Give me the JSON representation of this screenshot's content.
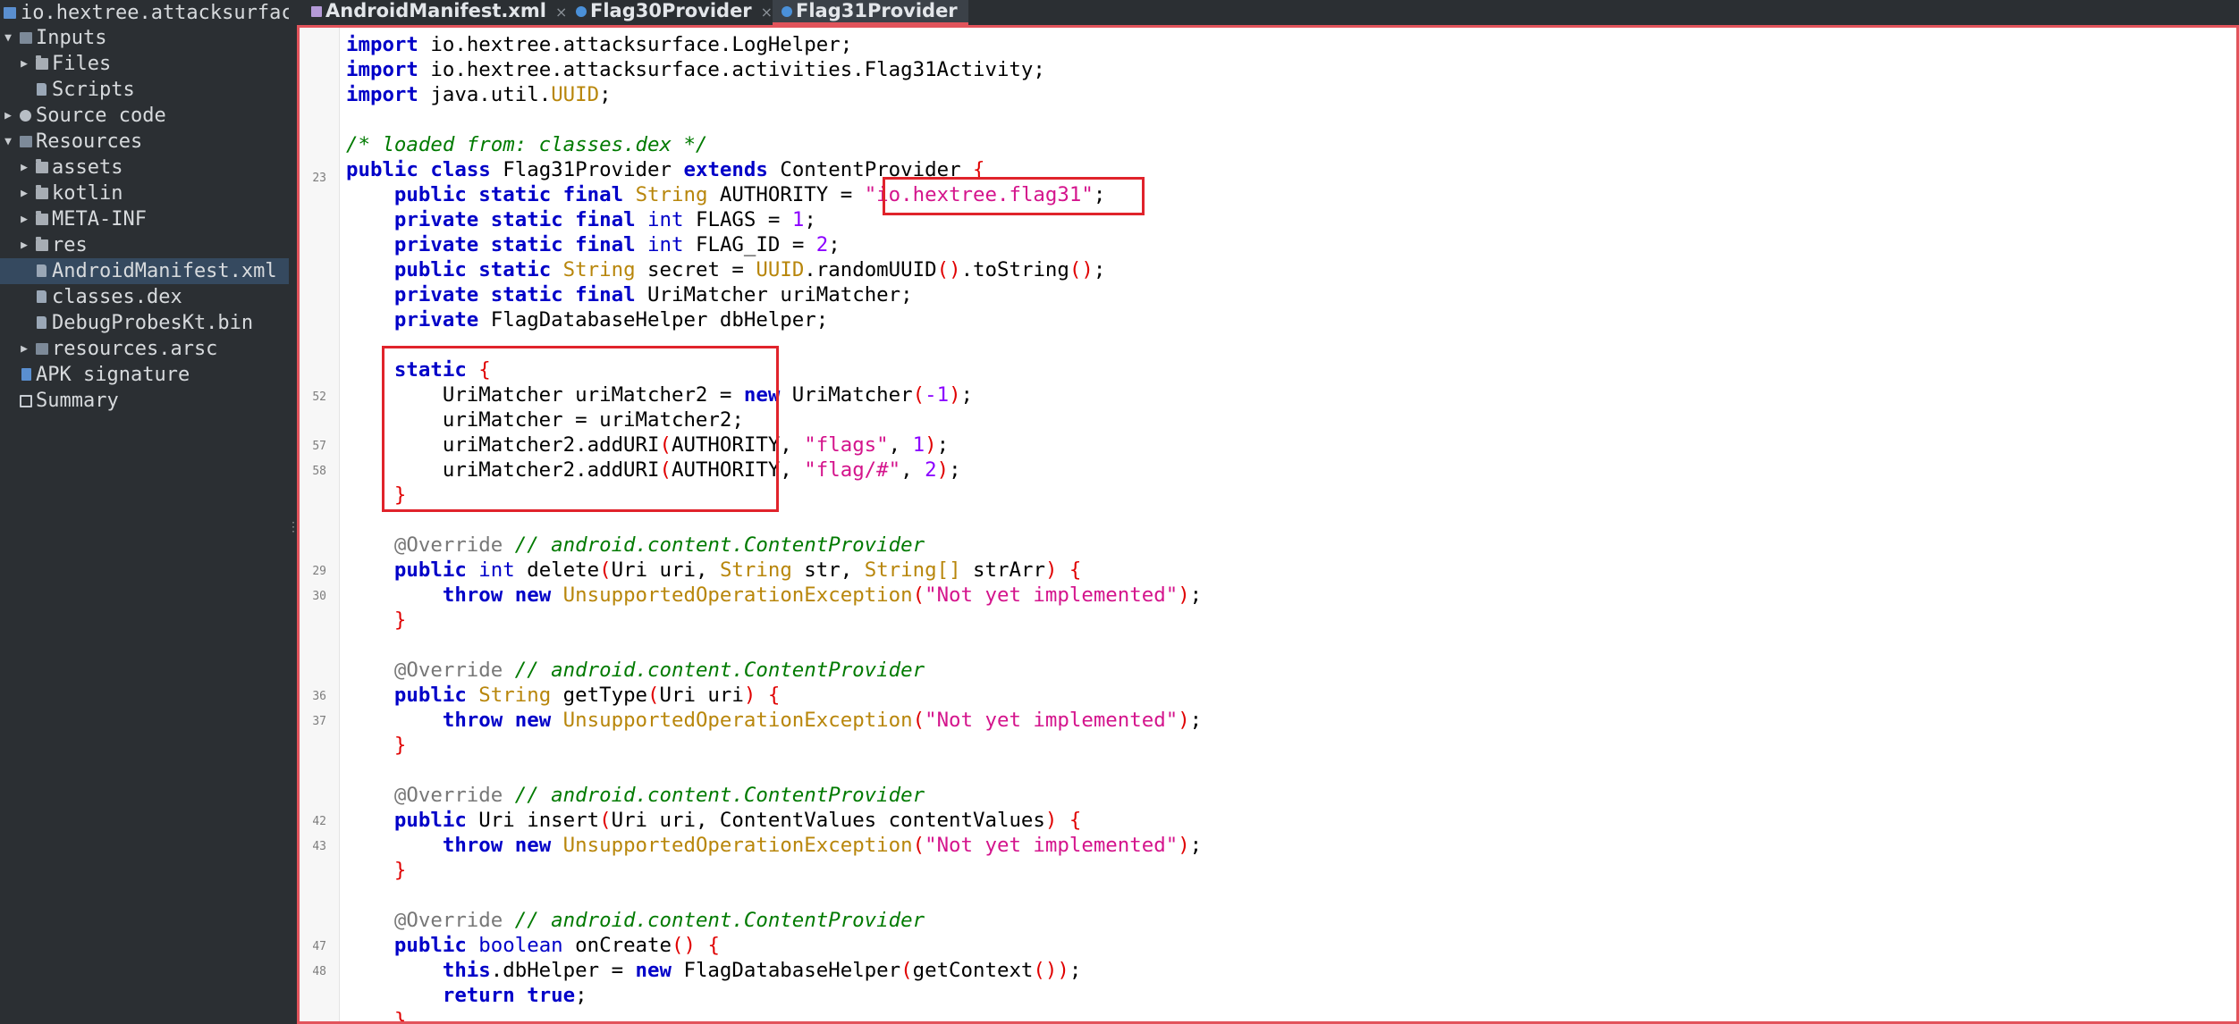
{
  "sidebar": {
    "project_title": "io.hextree.attacksurfac",
    "items": [
      {
        "label": "Inputs"
      },
      {
        "label": "Files"
      },
      {
        "label": "Scripts"
      },
      {
        "label": "Source code"
      },
      {
        "label": "Resources"
      },
      {
        "label": "assets"
      },
      {
        "label": "kotlin"
      },
      {
        "label": "META-INF"
      },
      {
        "label": "res"
      },
      {
        "label": "AndroidManifest.xml"
      },
      {
        "label": "classes.dex"
      },
      {
        "label": "DebugProbesKt.bin"
      },
      {
        "label": "resources.arsc"
      },
      {
        "label": "APK signature"
      },
      {
        "label": "Summary"
      }
    ]
  },
  "tabs": [
    {
      "label": "AndroidManifest.xml",
      "close": "×"
    },
    {
      "label": "Flag30Provider",
      "close": "×"
    },
    {
      "label": "Flag31Provider",
      "close": ""
    }
  ],
  "gutter": [
    "23",
    "52",
    "57",
    "58",
    "29",
    "30",
    "36",
    "37",
    "42",
    "43",
    "47",
    "48"
  ],
  "code": {
    "imp1_pkg": "io.hextree.attacksurface.LogHelper;",
    "imp2_pkg": "io.hextree.attacksurface.activities.Flag31Activity;",
    "imp3_pkg": "java.util.",
    "imp3_cls": "UUID",
    "import_kw": "import",
    "loaded_comment": "/* loaded from: classes.dex */",
    "class_name": "Flag31Provider",
    "super_name": "ContentProvider",
    "authority_value": "\"io.hextree.flag31\"",
    "flags_value": "1",
    "flag_id_value": "2",
    "um_init": "-1",
    "flags_path": "\"flags\"",
    "flag_path": "\"flag/#\"",
    "add_code_1": "1",
    "add_code_2": "2",
    "override": "@Override",
    "cp_comment": "// android.content.ContentProvider",
    "not_impl": "\"Not yet implemented\""
  }
}
